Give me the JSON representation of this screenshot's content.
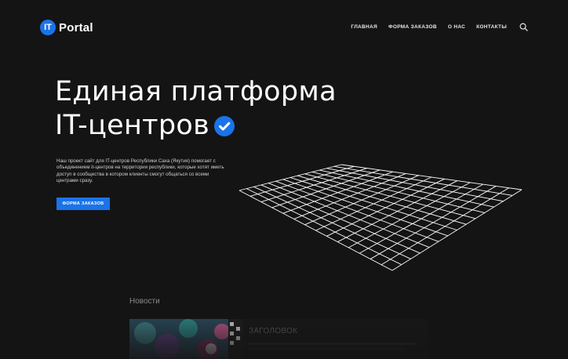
{
  "header": {
    "logo_badge": "IT",
    "logo_text": "Portal",
    "nav": [
      "ГЛАВНАЯ",
      "ФОРМА ЗАКАЗОВ",
      "О НАС",
      "КОНТАКТЫ"
    ],
    "search_icon": "search-icon"
  },
  "hero": {
    "title_line1": "Единая платформа",
    "title_line2": "IT-центров",
    "title_icon": "verified-check-icon",
    "description": "Наш проект сайт для IT-центров Республики Саха (Якутия) помогает с объединением it-центров на территории республики, которые хотят иметь доступ в сообщества в котором клиенты смогут общаться со всеми центрами сразу.",
    "cta_label": "ФОРМА ЗАКАЗОВ"
  },
  "news": {
    "heading": "Новости",
    "cards": [
      {
        "title": "ЗАГОЛОВОК"
      }
    ]
  },
  "colors": {
    "background": "#141414",
    "accent": "#1a73e8",
    "text": "#ffffff"
  }
}
